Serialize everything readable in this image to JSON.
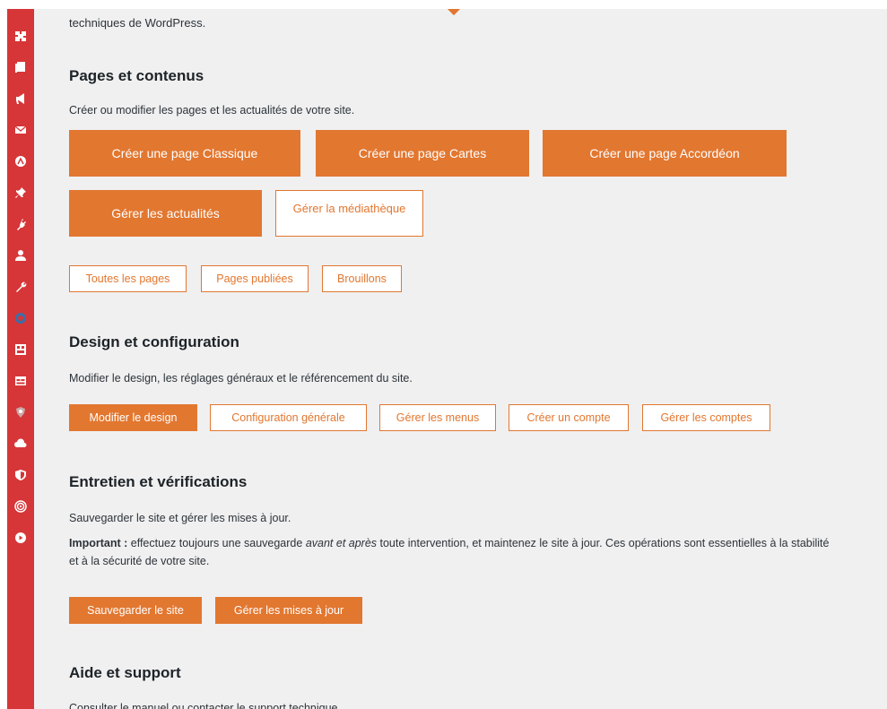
{
  "intro": {
    "text": "techniques de WordPress."
  },
  "sidebar": {
    "icons": [
      "puzzle-icon",
      "pages-icon",
      "megaphone-icon",
      "mail-icon",
      "gauge-icon",
      "pin-icon",
      "plug-icon",
      "user-icon",
      "wrench-icon",
      "circle-plugin-icon",
      "grid-icon",
      "layout-icon",
      "shield-crest-icon",
      "cloud-icon",
      "shield-icon",
      "wifi-icon",
      "play-icon"
    ]
  },
  "pages": {
    "title": "Pages et contenus",
    "description": "Créer ou modifier les pages et les actualités de votre site.",
    "btn_classique": "Créer une page Classique",
    "btn_cartes": "Créer une page Cartes",
    "btn_accordeon": "Créer une page Accordéon",
    "btn_actualites": "Gérer les actualités",
    "btn_mediatheque": "Gérer la médiathèque",
    "btn_toutes": "Toutes les pages",
    "btn_publiees": "Pages publiées",
    "btn_brouillons": "Brouillons"
  },
  "design": {
    "title": "Design et configuration",
    "description": "Modifier le design, les réglages généraux et le référencement du site.",
    "btn_design": "Modifier le design",
    "btn_config": "Configuration générale",
    "btn_menus": "Gérer les menus",
    "btn_compte": "Créer un compte",
    "btn_comptes": "Gérer les comptes"
  },
  "maintenance": {
    "title": "Entretien et vérifications",
    "description": "Sauvegarder le site et gérer les mises à jour.",
    "important_label": "Important :",
    "important_pre": " effectuez toujours une sauvegarde ",
    "important_em": "avant et après",
    "important_post": " toute intervention, et maintenez le site à jour. Ces opérations sont essentielles à la stabilité et à la sécurité de votre site.",
    "btn_save": "Sauvegarder le site",
    "btn_updates": "Gérer les mises à jour"
  },
  "support": {
    "title": "Aide et support",
    "description": "Consulter le manuel ou contacter le support technique."
  },
  "colors": {
    "accent": "#e27730",
    "sidebar": "#d63638",
    "background": "#f0f0f1"
  }
}
